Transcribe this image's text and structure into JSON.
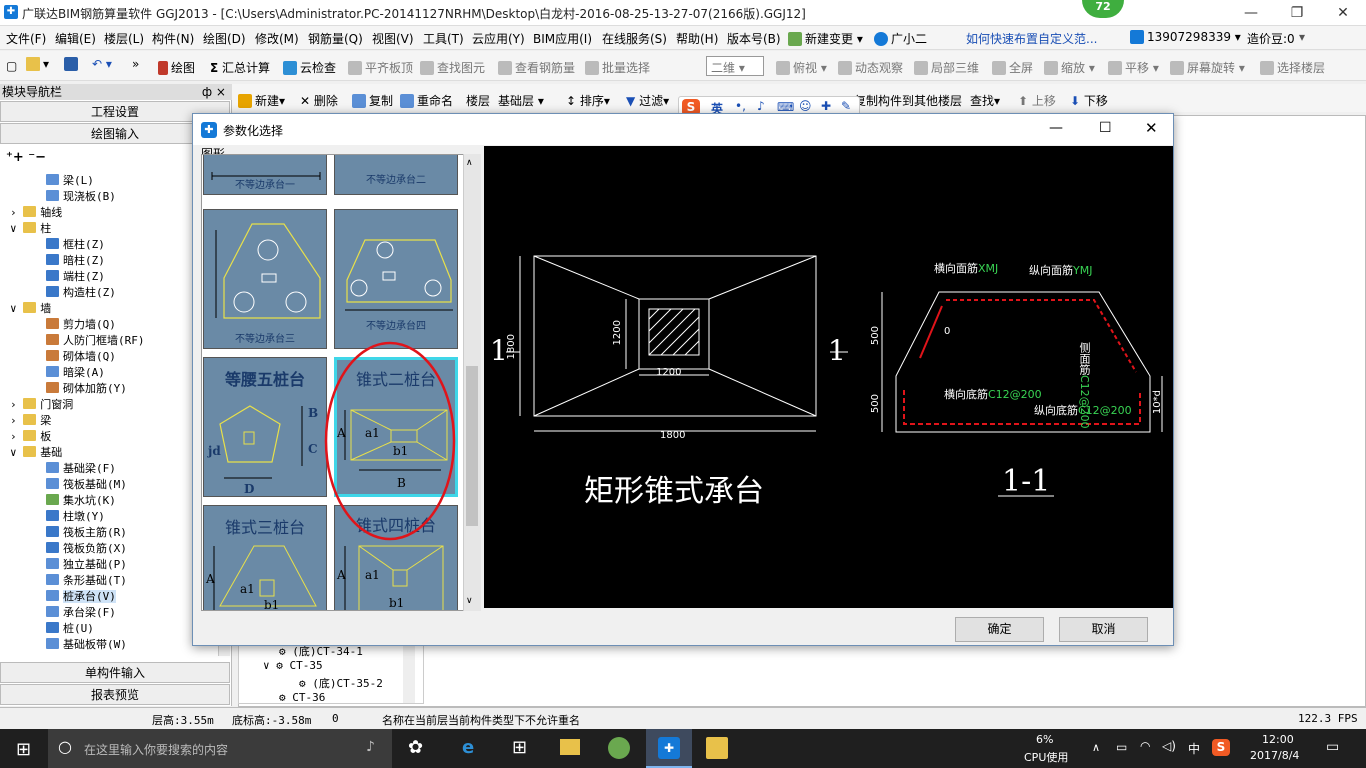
{
  "window": {
    "title": "广联达BIM钢筋算量软件 GGJ2013 - [C:\\Users\\Administrator.PC-20141127NRHM\\Desktop\\白龙村-2016-08-25-13-27-07(2166版).GGJ12]",
    "badge": "72",
    "minimize": "—",
    "maximize": "❐",
    "close": "✕"
  },
  "menu": {
    "items": [
      "文件(F)",
      "编辑(E)",
      "楼层(L)",
      "构件(N)",
      "绘图(D)",
      "修改(M)",
      "钢筋量(Q)",
      "视图(V)",
      "工具(T)",
      "云应用(Y)",
      "BIM应用(I)",
      "在线服务(S)",
      "帮助(H)",
      "版本号(B)"
    ],
    "new_change": "新建变更",
    "assistant": "广小二",
    "help_link": "如何快速布置自定义范...",
    "phone": "13907298339",
    "price": "造价豆:0"
  },
  "toolbar1": {
    "draw": "绘图",
    "sum": "汇总计算",
    "cloud_check": "云检查",
    "flat_top": "平齐板顶",
    "find_elem": "查找图元",
    "view_rebar": "查看钢筋量",
    "batch_select": "批量选择",
    "view_mode": "二维",
    "top_view": "俯视",
    "dynamic": "动态观察",
    "local_3d": "局部三维",
    "fullscreen": "全屏",
    "zoom": "缩放",
    "pan": "平移",
    "rotate": "屏幕旋转",
    "select_floor": "选择楼层"
  },
  "toolbar2": {
    "new": "新建",
    "delete": "删除",
    "copy": "复制",
    "rename": "重命名",
    "floor": "楼层",
    "floor_value": "基础层",
    "sort": "排序",
    "filter": "过滤",
    "copy_to_floors": "复制构件到其他楼层",
    "find": "查找",
    "move_up": "上移",
    "move_down": "下移"
  },
  "sidebar": {
    "header": "模块导航栏",
    "header_pin": "ф ×",
    "project_settings": "工程设置",
    "drawing_input": "绘图输入",
    "single_input": "单构件输入",
    "report_preview": "报表预览",
    "tree": [
      {
        "label": "梁(L)",
        "level": 3,
        "icon": "beam"
      },
      {
        "label": "现浇板(B)",
        "level": 3,
        "icon": "slab"
      },
      {
        "label": "轴线",
        "level": 1,
        "icon": "folder",
        "toggle": "›"
      },
      {
        "label": "柱",
        "level": 1,
        "icon": "folder",
        "toggle": "∨"
      },
      {
        "label": "框柱(Z)",
        "level": 2,
        "icon": "column"
      },
      {
        "label": "暗柱(Z)",
        "level": 2,
        "icon": "column"
      },
      {
        "label": "端柱(Z)",
        "level": 2,
        "icon": "column"
      },
      {
        "label": "构造柱(Z)",
        "level": 2,
        "icon": "column"
      },
      {
        "label": "墙",
        "level": 1,
        "icon": "folder",
        "toggle": "∨"
      },
      {
        "label": "剪力墙(Q)",
        "level": 2,
        "icon": "wall"
      },
      {
        "label": "人防门框墙(RF)",
        "level": 2,
        "icon": "wall"
      },
      {
        "label": "砌体墙(Q)",
        "level": 2,
        "icon": "wall"
      },
      {
        "label": "暗梁(A)",
        "level": 2,
        "icon": "beam"
      },
      {
        "label": "砌体加筋(Y)",
        "level": 2,
        "icon": "wall"
      },
      {
        "label": "门窗洞",
        "level": 1,
        "icon": "folder",
        "toggle": "›"
      },
      {
        "label": "梁",
        "level": 1,
        "icon": "folder",
        "toggle": "›"
      },
      {
        "label": "板",
        "level": 1,
        "icon": "folder",
        "toggle": "›"
      },
      {
        "label": "基础",
        "level": 1,
        "icon": "folder",
        "toggle": "∨"
      },
      {
        "label": "基础梁(F)",
        "level": 2,
        "icon": "beam"
      },
      {
        "label": "筏板基础(M)",
        "level": 2,
        "icon": "slab"
      },
      {
        "label": "集水坑(K)",
        "level": 2,
        "icon": "pit"
      },
      {
        "label": "柱墩(Y)",
        "level": 2,
        "icon": "column"
      },
      {
        "label": "筏板主筋(R)",
        "level": 2,
        "icon": "rebar"
      },
      {
        "label": "筏板负筋(X)",
        "level": 2,
        "icon": "rebar"
      },
      {
        "label": "独立基础(P)",
        "level": 2,
        "icon": "found"
      },
      {
        "label": "条形基础(T)",
        "level": 2,
        "icon": "found"
      },
      {
        "label": "桩承台(V)",
        "level": 2,
        "icon": "cap",
        "selected": true
      },
      {
        "label": "承台梁(F)",
        "level": 2,
        "icon": "beam"
      },
      {
        "label": "桩(U)",
        "level": 2,
        "icon": "pile"
      },
      {
        "label": "基础板带(W)",
        "level": 2,
        "icon": "slab"
      }
    ]
  },
  "component_tree": {
    "items": [
      "(底)CT-34-1",
      "CT-35",
      "(底)CT-35-2",
      "CT-36"
    ]
  },
  "dialog": {
    "title": "参数化选择",
    "shapes_label": "图形",
    "thumbnails": [
      {
        "label": "不等边承台一"
      },
      {
        "label": "不等边承台二"
      },
      {
        "label": "不等边承台三"
      },
      {
        "label": "不等边承台四"
      },
      {
        "label": "等腰五桩台",
        "dim_labels": [
          "B",
          "C",
          "jd",
          "D"
        ]
      },
      {
        "label": "锥式二桩台",
        "dim_labels": [
          "A",
          "a1",
          "b1",
          "B"
        ],
        "selected": true
      },
      {
        "label": "锥式三桩台",
        "dim_labels": [
          "A",
          "a1",
          "b1"
        ]
      },
      {
        "label": "锥式四桩台",
        "dim_labels": [
          "A",
          "a1",
          "b1"
        ]
      }
    ],
    "preview": {
      "title": "矩形锥式承台",
      "section_title": "1-1",
      "section_mark": "1",
      "dim_1800_w": "1800",
      "dim_1800_h": "1800",
      "dim_1200_w": "1200",
      "dim_1200_h": "1200",
      "dim_500_top": "500",
      "dim_500_bot": "500",
      "dim_side": "10*d",
      "dim_zero": "0",
      "label_top_h": "横向面筋",
      "code_top_h": "XMJ",
      "label_top_v": "纵向面筋",
      "code_top_v": "YMJ",
      "label_side": "侧面筋",
      "code_side": "C12@200",
      "label_bot_h": "横向底筋",
      "code_bot_h": "C12@200",
      "label_bot_v": "纵向底筋",
      "code_bot_v": "C12@200"
    },
    "ok": "确定",
    "cancel": "取消"
  },
  "status": {
    "floor_height": "层高:3.55m",
    "bottom_elev": "底标高:-3.58m",
    "zero": "0",
    "message": "名称在当前层当前构件类型下不允许重名",
    "fps": "122.3 FPS"
  },
  "taskbar": {
    "search_placeholder": "在这里输入你要搜索的内容",
    "cpu_pct": "6%",
    "cpu_label": "CPU使用",
    "ime": "中",
    "time": "12:00",
    "date": "2017/8/4",
    "sogou_lang": "英"
  },
  "colors": {
    "accent": "#1479d7",
    "thumb_bg": "#6a8aa6",
    "selected_outline": "#e0141a",
    "cad_green": "#39d353"
  }
}
